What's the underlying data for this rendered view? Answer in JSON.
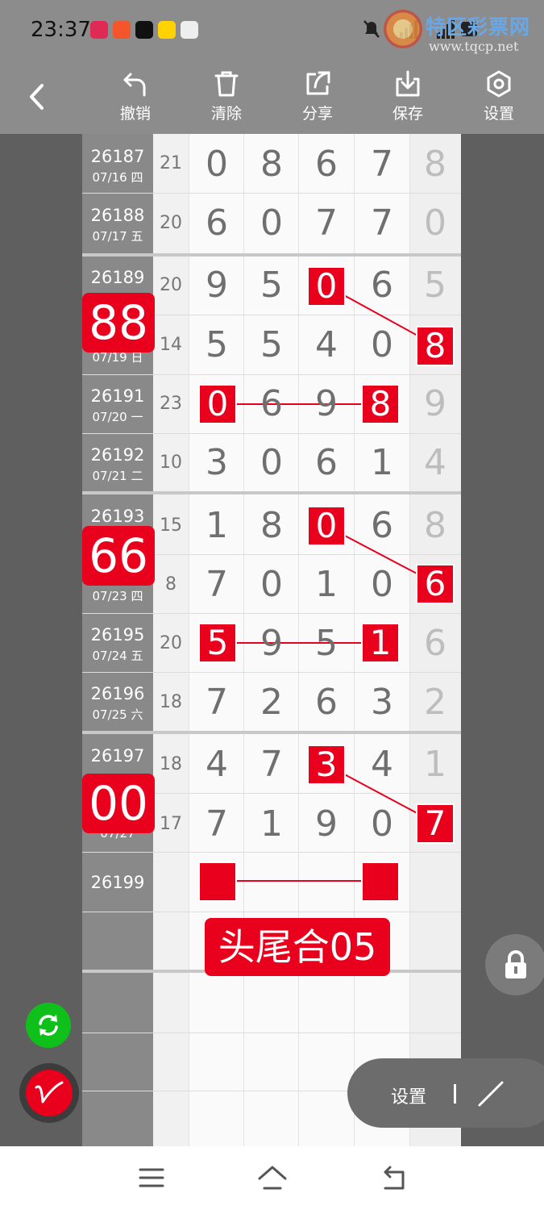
{
  "status": {
    "time": "23:37"
  },
  "watermark": {
    "title": "特区彩票网",
    "url": "www.tqcp.net"
  },
  "toolbar": {
    "undo_label": "撤销",
    "clear_label": "清除",
    "share_label": "分享",
    "save_label": "保存",
    "settings_label": "设置"
  },
  "rows": [
    {
      "id": "26187",
      "date": "07/16 四",
      "sum": "21",
      "d1": "0",
      "d2": "8",
      "d3": "6",
      "d4": "7",
      "last": "8"
    },
    {
      "id": "26188",
      "date": "07/17 五",
      "sum": "20",
      "d1": "6",
      "d2": "0",
      "d3": "7",
      "d4": "7",
      "last": "0"
    },
    {
      "id": "26189",
      "date": "",
      "sum": "20",
      "d1": "9",
      "d2": "5",
      "d3": "0",
      "d4": "6",
      "last": "5"
    },
    {
      "id": "",
      "date": "07/19 日",
      "sum": "14",
      "d1": "5",
      "d2": "5",
      "d3": "4",
      "d4": "0",
      "last": "8"
    },
    {
      "id": "26191",
      "date": "07/20 一",
      "sum": "23",
      "d1": "0",
      "d2": "6",
      "d3": "9",
      "d4": "8",
      "last": "9"
    },
    {
      "id": "26192",
      "date": "07/21 二",
      "sum": "10",
      "d1": "3",
      "d2": "0",
      "d3": "6",
      "d4": "1",
      "last": "4"
    },
    {
      "id": "26193",
      "date": "",
      "sum": "15",
      "d1": "1",
      "d2": "8",
      "d3": "0",
      "d4": "6",
      "last": "8"
    },
    {
      "id": "",
      "date": "07/23 四",
      "sum": "8",
      "d1": "7",
      "d2": "0",
      "d3": "1",
      "d4": "0",
      "last": "6"
    },
    {
      "id": "26195",
      "date": "07/24 五",
      "sum": "20",
      "d1": "5",
      "d2": "9",
      "d3": "5",
      "d4": "1",
      "last": "6"
    },
    {
      "id": "26196",
      "date": "07/25 六",
      "sum": "18",
      "d1": "7",
      "d2": "2",
      "d3": "6",
      "d4": "3",
      "last": "2"
    },
    {
      "id": "26197",
      "date": "",
      "sum": "18",
      "d1": "4",
      "d2": "7",
      "d3": "3",
      "d4": "4",
      "last": "1"
    },
    {
      "id": "",
      "date": "07/27",
      "sum": "17",
      "d1": "7",
      "d2": "1",
      "d3": "9",
      "d4": "0",
      "last": "7"
    },
    {
      "id": "26199",
      "date": "",
      "sum": "",
      "d1": "",
      "d2": "",
      "d3": "",
      "d4": "",
      "last": ""
    }
  ],
  "badges": {
    "b1": "88",
    "b2": "66",
    "b3": "00"
  },
  "banner": "头尾合05",
  "pill": {
    "label": "设置"
  },
  "colors": {
    "accent_red": "#e8001c",
    "refresh_green": "#10c01a",
    "chrome_gray": "#8c8c8c"
  }
}
